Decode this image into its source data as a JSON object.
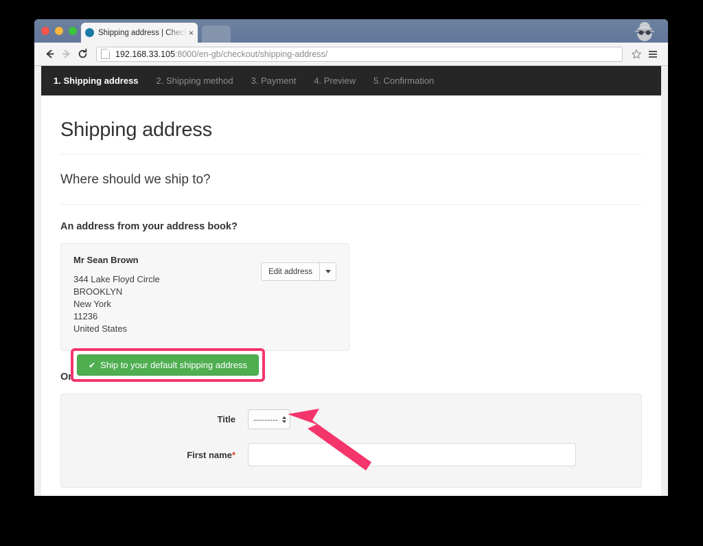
{
  "browser": {
    "tab": {
      "title": "Shipping address | Checko",
      "close_label": "×",
      "favicon": "circle-favicon"
    },
    "toolbar": {
      "back_icon": "back-arrow-icon",
      "forward_icon": "forward-arrow-icon",
      "reload_icon": "reload-icon",
      "star_icon": "bookmark-star-icon",
      "menu_icon": "hamburger-menu-icon",
      "incognito_icon": "incognito-spy-icon",
      "url_host": "192.168.33.105",
      "url_rest": ":8000/en-gb/checkout/shipping-address/",
      "url_full": "192.168.33.105:8000/en-gb/checkout/shipping-address/"
    }
  },
  "checkout_steps": [
    {
      "label": "1. Shipping address",
      "active": true
    },
    {
      "label": "2. Shipping method",
      "active": false
    },
    {
      "label": "3. Payment",
      "active": false
    },
    {
      "label": "4. Preview",
      "active": false
    },
    {
      "label": "5. Confirmation",
      "active": false
    }
  ],
  "page": {
    "title": "Shipping address",
    "subheading": "Where should we ship to?",
    "address_book_heading": "An address from your address book?",
    "new_address_heading": "Or a new address?"
  },
  "address_card": {
    "name": "Mr Sean Brown",
    "lines": [
      "344 Lake Floyd Circle",
      "BROOKLYN",
      "New York",
      "11236",
      "United States"
    ],
    "edit_button_label": "Edit address",
    "dropdown_icon": "chevron-down-icon",
    "ship_button_label": "Ship to your default shipping address",
    "ship_button_icon": "checkmark-icon",
    "ship_button_check": "✔"
  },
  "new_address_form": {
    "fields": [
      {
        "label": "Title",
        "required": false,
        "type": "select",
        "value": "---------"
      },
      {
        "label": "First name",
        "required": true,
        "type": "text",
        "value": ""
      }
    ],
    "required_marker": "*"
  },
  "annotation": {
    "highlight_color": "#f4356b",
    "arrow_color": "#f4356b",
    "target": "ship-to-default-shipping-address-button"
  },
  "colors": {
    "nav_bar": "#262626",
    "success_green": "#4eae50",
    "page_background": "#ffffff",
    "panel_background": "#f5f5f5",
    "required_red": "#e03b24"
  }
}
